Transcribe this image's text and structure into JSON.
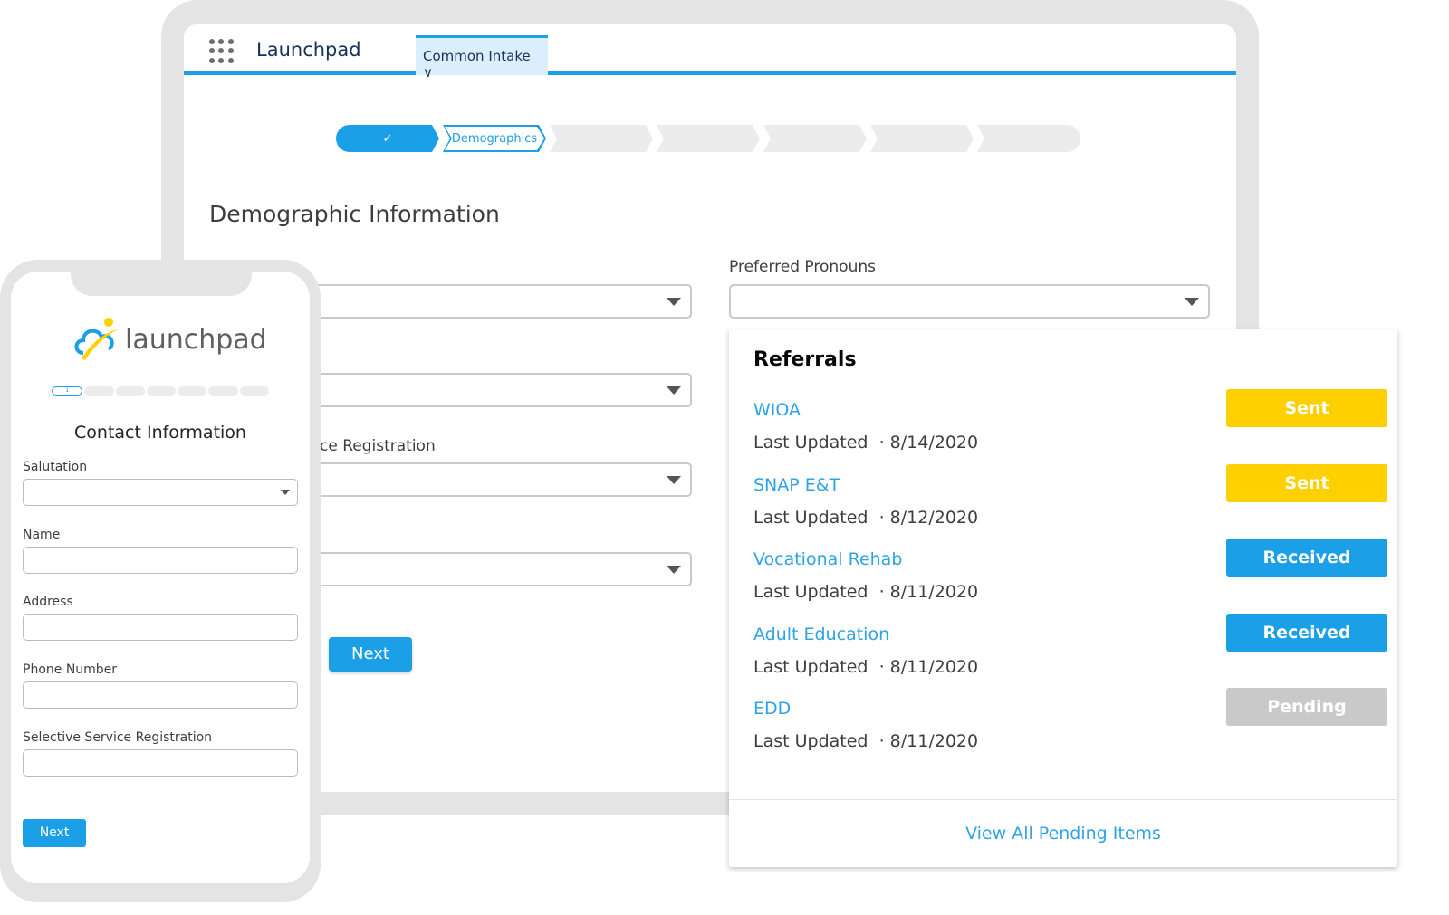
{
  "app": {
    "name": "Launchpad",
    "tab": "Common Intake",
    "tab_chevron": "∨"
  },
  "path": {
    "steps": [
      "✓",
      "Demographics",
      "",
      "",
      "",
      "",
      ""
    ],
    "current": 1
  },
  "page": {
    "title": "Demographic Information",
    "labels": {
      "preferred_pronouns": "Preferred Pronouns",
      "service_registration": "ce Registration"
    },
    "next": "Next"
  },
  "phone": {
    "logo": "launchpad",
    "progress_step": "1",
    "title": "Contact Information",
    "fields": [
      "Salutation",
      "Name",
      "Address",
      "Phone Number",
      "Selective Service Registration"
    ],
    "next": "Next"
  },
  "referrals": {
    "title": "Referrals",
    "items": [
      {
        "name": "WIOA",
        "updated_label": "Last Updated",
        "date": "8/14/2020",
        "status": "Sent",
        "color": "#ffd000"
      },
      {
        "name": "SNAP E&T",
        "updated_label": "Last Updated",
        "date": "8/12/2020",
        "status": "Sent",
        "color": "#ffd000"
      },
      {
        "name": "Vocational Rehab",
        "updated_label": "Last Updated",
        "date": "8/11/2020",
        "status": "Received",
        "color": "#1b9fe6"
      },
      {
        "name": "Adult Education",
        "updated_label": "Last Updated",
        "date": "8/11/2020",
        "status": "Received",
        "color": "#1b9fe6"
      },
      {
        "name": "EDD",
        "updated_label": "Last Updated",
        "date": "8/11/2020",
        "status": "Pending",
        "color": "#c9c9c9"
      }
    ],
    "footer": "View All Pending Items"
  }
}
